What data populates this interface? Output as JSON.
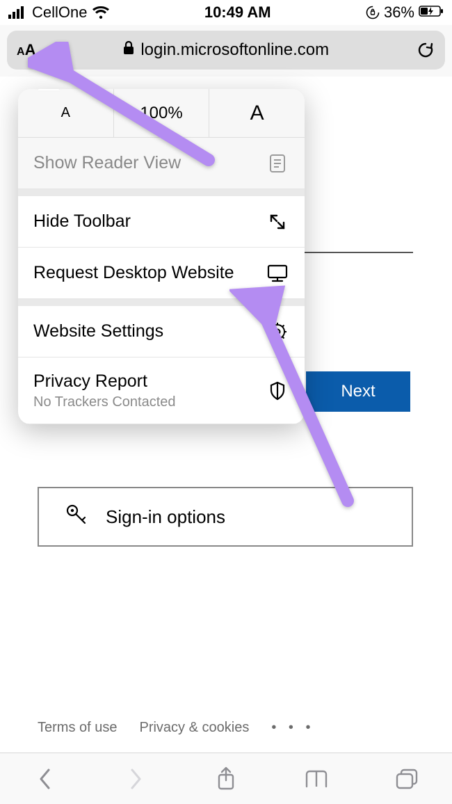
{
  "status": {
    "carrier": "CellOne",
    "time": "10:49 AM",
    "battery": "36%"
  },
  "address_bar": {
    "aa_small": "A",
    "aa_large": "A",
    "url": "login.microsoftonline.com"
  },
  "popup": {
    "zoom_small": "A",
    "zoom_value": "100%",
    "zoom_large": "A",
    "reader": "Show Reader View",
    "hide_toolbar": "Hide Toolbar",
    "request_desktop": "Request Desktop Website",
    "website_settings": "Website Settings",
    "privacy_report": "Privacy Report",
    "privacy_sub": "No Trackers Contacted"
  },
  "page": {
    "next": "Next",
    "signin_options": "Sign-in options"
  },
  "footer": {
    "terms": "Terms of use",
    "privacy": "Privacy & cookies",
    "dots": "• • •"
  }
}
